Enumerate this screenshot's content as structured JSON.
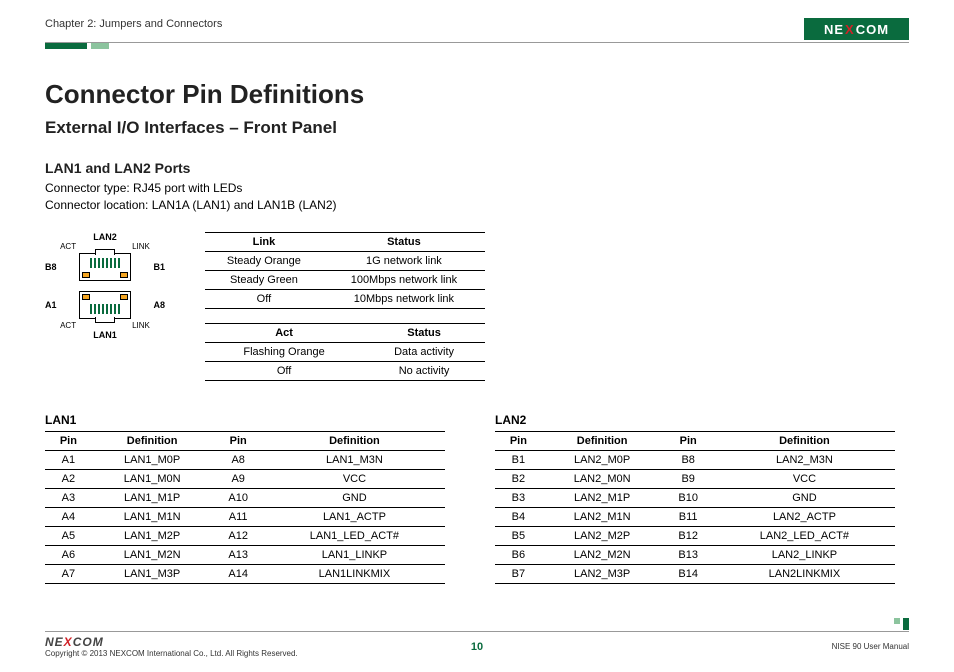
{
  "header": {
    "chapter": "Chapter 2: Jumpers and Connectors",
    "logo_text_pre": "NE",
    "logo_text_x": "X",
    "logo_text_post": "COM"
  },
  "title": "Connector Pin Definitions",
  "subtitle": "External I/O Interfaces – Front Panel",
  "section_heading": "LAN1 and LAN2 Ports",
  "connector_type_line": "Connector type: RJ45 port with LEDs",
  "connector_loc_line": "Connector location: LAN1A (LAN1) and LAN1B (LAN2)",
  "diagram": {
    "top_label": "LAN2",
    "bottom_label": "LAN1",
    "act": "ACT",
    "link": "LINK",
    "b8": "B8",
    "b1": "B1",
    "a1": "A1",
    "a8": "A8"
  },
  "link_table": {
    "headers": [
      "Link",
      "Status"
    ],
    "rows": [
      [
        "Steady Orange",
        "1G network link"
      ],
      [
        "Steady Green",
        "100Mbps network link"
      ],
      [
        "Off",
        "10Mbps network link"
      ]
    ]
  },
  "act_table": {
    "headers": [
      "Act",
      "Status"
    ],
    "rows": [
      [
        "Flashing Orange",
        "Data activity"
      ],
      [
        "Off",
        "No activity"
      ]
    ]
  },
  "lan1": {
    "label": "LAN1",
    "headers": [
      "Pin",
      "Definition",
      "Pin",
      "Definition"
    ],
    "rows": [
      [
        "A1",
        "LAN1_M0P",
        "A8",
        "LAN1_M3N"
      ],
      [
        "A2",
        "LAN1_M0N",
        "A9",
        "VCC"
      ],
      [
        "A3",
        "LAN1_M1P",
        "A10",
        "GND"
      ],
      [
        "A4",
        "LAN1_M1N",
        "A11",
        "LAN1_ACTP"
      ],
      [
        "A5",
        "LAN1_M2P",
        "A12",
        "LAN1_LED_ACT#"
      ],
      [
        "A6",
        "LAN1_M2N",
        "A13",
        "LAN1_LINKP"
      ],
      [
        "A7",
        "LAN1_M3P",
        "A14",
        "LAN1LINKMIX"
      ]
    ]
  },
  "lan2": {
    "label": "LAN2",
    "headers": [
      "Pin",
      "Definition",
      "Pin",
      "Definition"
    ],
    "rows": [
      [
        "B1",
        "LAN2_M0P",
        "B8",
        "LAN2_M3N"
      ],
      [
        "B2",
        "LAN2_M0N",
        "B9",
        "VCC"
      ],
      [
        "B3",
        "LAN2_M1P",
        "B10",
        "GND"
      ],
      [
        "B4",
        "LAN2_M1N",
        "B11",
        "LAN2_ACTP"
      ],
      [
        "B5",
        "LAN2_M2P",
        "B12",
        "LAN2_LED_ACT#"
      ],
      [
        "B6",
        "LAN2_M2N",
        "B13",
        "LAN2_LINKP"
      ],
      [
        "B7",
        "LAN2_M3P",
        "B14",
        "LAN2LINKMIX"
      ]
    ]
  },
  "footer": {
    "logo_pre": "NE",
    "logo_x": "X",
    "logo_post": "COM",
    "copyright": "Copyright © 2013 NEXCOM International Co., Ltd. All Rights Reserved.",
    "page": "10",
    "manual": "NISE 90 User Manual"
  }
}
